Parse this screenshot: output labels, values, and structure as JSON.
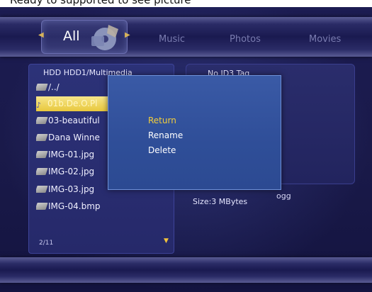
{
  "top_caption": "Ready to supported to see picture",
  "tabs": [
    {
      "label": "All",
      "active": true
    },
    {
      "label": "Music",
      "active": false
    },
    {
      "label": "Photos",
      "active": false
    },
    {
      "label": "Movies",
      "active": false
    }
  ],
  "file_browser": {
    "path": "HDD  HDD1/Multimedia",
    "items": [
      {
        "label": "/../",
        "icon": "folder-icon",
        "selected": false
      },
      {
        "label": "01b.De.O.Pl",
        "icon": "music-note-icon",
        "selected": true
      },
      {
        "label": "03-beautiful",
        "icon": "folder-icon",
        "selected": false
      },
      {
        "label": "Dana Winne",
        "icon": "folder-icon",
        "selected": false
      },
      {
        "label": "IMG-01.jpg",
        "icon": "folder-icon",
        "selected": false
      },
      {
        "label": "IMG-02.jpg",
        "icon": "folder-icon",
        "selected": false
      },
      {
        "label": "IMG-03.jpg",
        "icon": "folder-icon",
        "selected": false
      },
      {
        "label": "IMG-04.bmp",
        "icon": "folder-icon",
        "selected": false
      }
    ],
    "page_indicator": "2/11"
  },
  "info_panel": {
    "id3": "No ID3 Tag",
    "extension_fragment": "ogg",
    "size": "Size:3 MBytes"
  },
  "popup_menu": {
    "items": [
      {
        "label": "Return",
        "active": true
      },
      {
        "label": "Rename",
        "active": false
      },
      {
        "label": "Delete",
        "active": false
      }
    ]
  },
  "colors": {
    "background": "#1a1a4a",
    "selection": "#e8c83c",
    "popup": "#2f4e98",
    "active_menu_text": "#f4cf3a"
  }
}
